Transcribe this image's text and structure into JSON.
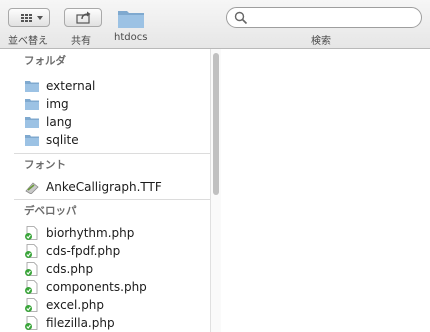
{
  "toolbar": {
    "arrange_label": "並べ替え",
    "share_label": "共有",
    "folder_label": "htdocs",
    "search_label": "検索",
    "search_value": ""
  },
  "sections": {
    "folders": {
      "header": "フォルダ",
      "items": [
        "external",
        "img",
        "lang",
        "sqlite"
      ]
    },
    "fonts": {
      "header": "フォント",
      "items": [
        "AnkeCalligraph.TTF"
      ]
    },
    "developer": {
      "header": "デベロッパ",
      "items": [
        "biorhythm.php",
        "cds-fpdf.php",
        "cds.php",
        "components.php",
        "excel.php",
        "filezilla.php"
      ]
    }
  },
  "colors": {
    "folder": "#8fb6da",
    "php_doc": "#ffffff",
    "php_check": "#3aa53a"
  }
}
